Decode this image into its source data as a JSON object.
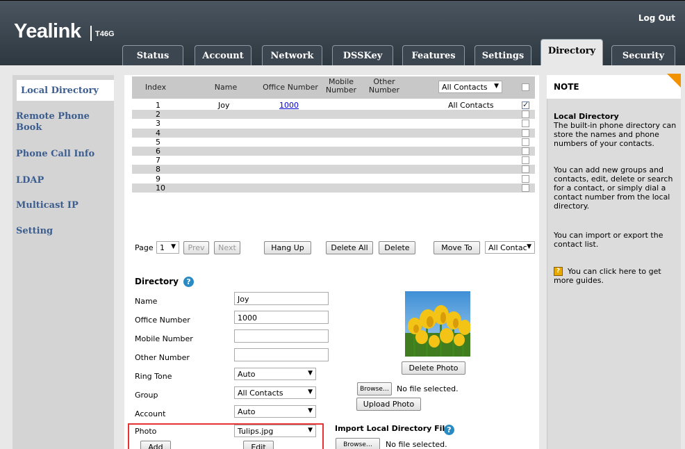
{
  "header": {
    "logo": "Yealink",
    "model": "T46G",
    "logout": "Log Out",
    "tabs": [
      "Status",
      "Account",
      "Network",
      "DSSKey",
      "Features",
      "Settings",
      "Directory",
      "Security"
    ],
    "active_tab": "Directory"
  },
  "sidebar": {
    "items": [
      "Local Directory",
      "Remote Phone Book",
      "Phone Call Info",
      "LDAP",
      "Multicast IP",
      "Setting"
    ],
    "active": "Local Directory"
  },
  "table": {
    "headers": {
      "index": "Index",
      "name": "Name",
      "office": "Office Number",
      "mobile": "Mobile Number",
      "other": "Other Number",
      "group_filter": "All Contacts"
    },
    "rows": [
      {
        "index": "1",
        "name": "Joy",
        "office": "1000",
        "group": "All Contacts",
        "checked": true
      },
      {
        "index": "2",
        "name": "",
        "office": "",
        "group": "",
        "checked": false
      },
      {
        "index": "3",
        "name": "",
        "office": "",
        "group": "",
        "checked": false
      },
      {
        "index": "4",
        "name": "",
        "office": "",
        "group": "",
        "checked": false
      },
      {
        "index": "5",
        "name": "",
        "office": "",
        "group": "",
        "checked": false
      },
      {
        "index": "6",
        "name": "",
        "office": "",
        "group": "",
        "checked": false
      },
      {
        "index": "7",
        "name": "",
        "office": "",
        "group": "",
        "checked": false
      },
      {
        "index": "8",
        "name": "",
        "office": "",
        "group": "",
        "checked": false
      },
      {
        "index": "9",
        "name": "",
        "office": "",
        "group": "",
        "checked": false
      },
      {
        "index": "10",
        "name": "",
        "office": "",
        "group": "",
        "checked": false
      }
    ]
  },
  "toolbar": {
    "page_label": "Page",
    "page_value": "1",
    "prev": "Prev",
    "next": "Next",
    "hang_up": "Hang Up",
    "delete_all": "Delete All",
    "delete": "Delete",
    "move_to": "Move To",
    "move_target": "All Contac"
  },
  "form": {
    "title": "Directory",
    "name_label": "Name",
    "name_value": "Joy",
    "office_label": "Office Number",
    "office_value": "1000",
    "mobile_label": "Mobile Number",
    "mobile_value": "",
    "other_label": "Other Number",
    "other_value": "",
    "ring_label": "Ring Tone",
    "ring_value": "Auto",
    "group_label": "Group",
    "group_value": "All Contacts",
    "account_label": "Account",
    "account_value": "Auto",
    "photo_label": "Photo",
    "photo_value": "Tulips.jpg",
    "add": "Add",
    "edit": "Edit",
    "delete_photo": "Delete Photo",
    "browse": "Browse…",
    "no_file": "No file selected.",
    "upload_photo": "Upload Photo",
    "import_title": "Import Local Directory File"
  },
  "note": {
    "title": "NOTE",
    "heading": "Local Directory",
    "p1": "The built-in phone directory can store the names and phone numbers of your contacts.",
    "p2": "You can add new groups and contacts, edit, delete or search for a contact, or simply dial a contact number from the local directory.",
    "p3": "You can import or export the contact list.",
    "p4": "You can click here to get more guides."
  },
  "colors": {
    "header_bg": "#3a4550",
    "nav_link": "#3b5d8f",
    "accent_orange": "#f39200",
    "highlight_box": "#e53333",
    "help_icon": "#2a8bc4"
  }
}
